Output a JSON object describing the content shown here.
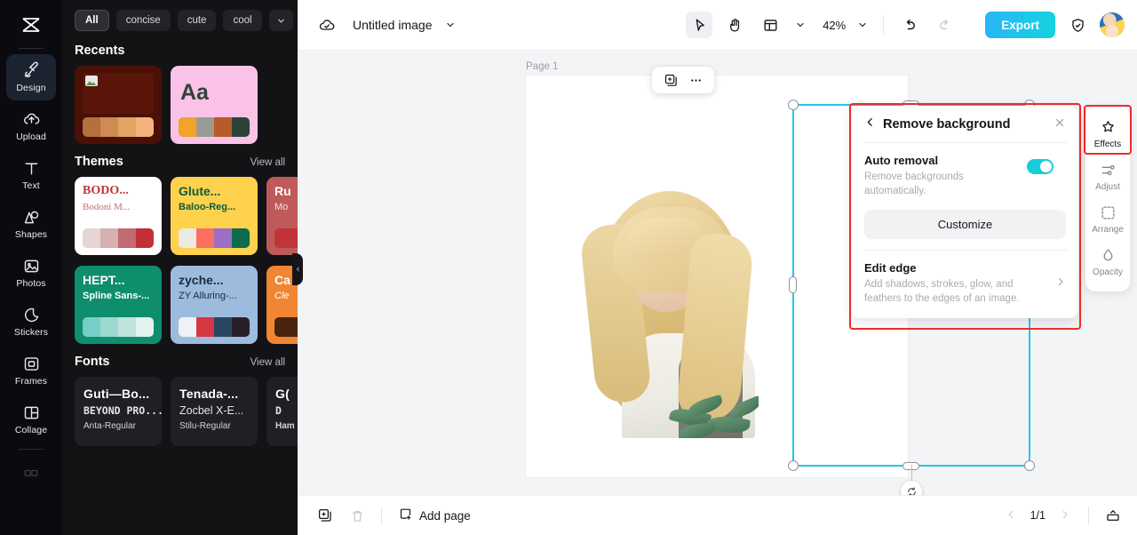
{
  "app": {
    "logo_icon": "capcut-logo-icon"
  },
  "left_rail": {
    "items": [
      {
        "label": "Design",
        "icon": "design-icon",
        "active": true
      },
      {
        "label": "Upload",
        "icon": "upload-cloud-icon",
        "active": false
      },
      {
        "label": "Text",
        "icon": "text-icon",
        "active": false
      },
      {
        "label": "Shapes",
        "icon": "shapes-icon",
        "active": false
      },
      {
        "label": "Photos",
        "icon": "photos-icon",
        "active": false
      },
      {
        "label": "Stickers",
        "icon": "sticker-icon",
        "active": false
      },
      {
        "label": "Frames",
        "icon": "frames-icon",
        "active": false
      },
      {
        "label": "Collage",
        "icon": "collage-icon",
        "active": false
      }
    ]
  },
  "template_panel": {
    "filter_chips": [
      {
        "label": "All",
        "selected": true
      },
      {
        "label": "concise",
        "selected": false
      },
      {
        "label": "cute",
        "selected": false
      },
      {
        "label": "cool",
        "selected": false
      }
    ],
    "chip_more_icon": "chevron-down-icon",
    "sections": {
      "recents": {
        "title": "Recents"
      },
      "themes": {
        "title": "Themes",
        "view_all": "View all"
      },
      "fonts": {
        "title": "Fonts",
        "view_all": "View all"
      }
    },
    "recents_cards": [
      {
        "name": "dark-brown-photo-template",
        "text": "",
        "bg": "#4a1006",
        "swatches": [
          "#b5703c",
          "#d08a53",
          "#e0a563",
          "#f6b27e"
        ]
      },
      {
        "name": "pink-aa-template",
        "text": "Aa",
        "bg": "#f9c2e6",
        "swatches": [
          "#f0a42b",
          "#9a9b93",
          "#b95a2c",
          "#2e4338"
        ]
      }
    ],
    "theme_cards": [
      {
        "title": "BODO...",
        "subtitle": "Bodoni M...",
        "bg": "#ffffff",
        "title_color": "#c0333a",
        "sub_color": "#c46a70",
        "swatches": [
          "#e7d4d4",
          "#d7b0b0",
          "#bf6b6f",
          "#c22f36"
        ]
      },
      {
        "title": "Glute...",
        "subtitle": "Baloo-Reg...",
        "bg": "#ffd24d",
        "title_color": "#0d5a3c",
        "sub_color": "#0d5a3c",
        "swatches": [
          "#eceae5",
          "#fb7063",
          "#9b6fc4",
          "#0e6b4b"
        ]
      },
      {
        "title": "Ru",
        "subtitle": "Mo",
        "bg": "#bf5a5a",
        "title_color": "#ffffff",
        "sub_color": "#f3dede",
        "swatches": [
          "#c0343a",
          "#c0343a",
          "#c0343a",
          "#c0343a"
        ]
      },
      {
        "title": "HEPT...",
        "subtitle": "Spline Sans-...",
        "bg": "#0e8e6d",
        "title_color": "#ffffff",
        "sub_color": "#ffffff",
        "swatches": [
          "#76cfc6",
          "#9cd8d0",
          "#bfe4de",
          "#e1f2ef"
        ]
      },
      {
        "title": "zyche...",
        "subtitle": "ZY Alluring-...",
        "bg": "#9dbbdd",
        "title_color": "#1c2b3f",
        "sub_color": "#1c2b3f",
        "swatches": [
          "#eef1f5",
          "#d53843",
          "#2b4663",
          "#2a1f26"
        ]
      },
      {
        "title": "Ca",
        "subtitle": "Cle",
        "bg": "#f08632",
        "title_color": "#ffffff",
        "sub_color": "#ffffff",
        "swatches": [
          "#4a2310",
          "#4a2310",
          "#4a2310",
          "#4a2310"
        ]
      }
    ],
    "font_cards": [
      {
        "line1": "Guti—Bo...",
        "line2": "BEYOND PRO...",
        "line3": "Anta-Regular"
      },
      {
        "line1": "Tenada-...",
        "line2": "Zocbel X-E...",
        "line3": "Stilu-Regular"
      },
      {
        "line1": "G(",
        "line2": "D",
        "line3": "Ham"
      }
    ],
    "scroll_next_icon": "chevron-right-icon",
    "collapse_handle_icon": "chevron-left-icon"
  },
  "topbar": {
    "cloud_icon": "cloud-saved-icon",
    "doc_title": "Untitled image",
    "title_caret_icon": "chevron-down-icon",
    "tools": [
      {
        "name": "select-tool",
        "icon": "cursor-arrow-icon",
        "active": true
      },
      {
        "name": "hand-tool",
        "icon": "hand-icon",
        "active": false
      },
      {
        "name": "layout-tool",
        "icon": "layout-icon",
        "active": false
      }
    ],
    "layout_caret_icon": "chevron-down-icon",
    "zoom_level": "42%",
    "zoom_caret_icon": "chevron-down-icon",
    "undo_icon": "undo-icon",
    "redo_icon": "redo-icon",
    "export_label": "Export",
    "shield_icon": "shield-check-icon",
    "avatar": "user-avatar"
  },
  "canvas": {
    "page_label": "Page 1",
    "float_toolbar": [
      {
        "name": "duplicate-button",
        "icon": "duplicate-icon"
      },
      {
        "name": "more-options-button",
        "icon": "more-horizontal-icon"
      }
    ],
    "rotate_icon": "rotate-icon",
    "image_alt": "blonde-woman-portrait-cutout"
  },
  "remove_bg_panel": {
    "back_icon": "chevron-left-icon",
    "title": "Remove background",
    "close_icon": "close-icon",
    "auto_removal": {
      "label": "Auto removal",
      "description": "Remove backgrounds automatically.",
      "toggle_on": true,
      "customize_label": "Customize"
    },
    "edit_edge": {
      "label": "Edit edge",
      "description": "Add shadows, strokes, glow, and feathers to the edges of an image.",
      "chevron_icon": "chevron-right-icon"
    },
    "highlight_color": "#ee2b2b"
  },
  "tool_rail": {
    "items": [
      {
        "label": "Effects",
        "icon": "effects-sparkle-icon",
        "active": true
      },
      {
        "label": "Adjust",
        "icon": "adjust-sliders-icon",
        "active": false
      },
      {
        "label": "Arrange",
        "icon": "arrange-icon",
        "active": false
      },
      {
        "label": "Opacity",
        "icon": "opacity-drop-icon",
        "active": false
      }
    ],
    "highlight_color": "#ee2b2b"
  },
  "bottombar": {
    "duplicate_page_icon": "duplicate-page-icon",
    "delete_icon": "trash-icon",
    "add_page_label": "Add page",
    "add_page_icon": "add-page-icon",
    "prev_icon": "chevron-left-icon",
    "next_icon": "chevron-right-icon",
    "page_indicator": "1/1",
    "present_icon": "present-icon"
  }
}
